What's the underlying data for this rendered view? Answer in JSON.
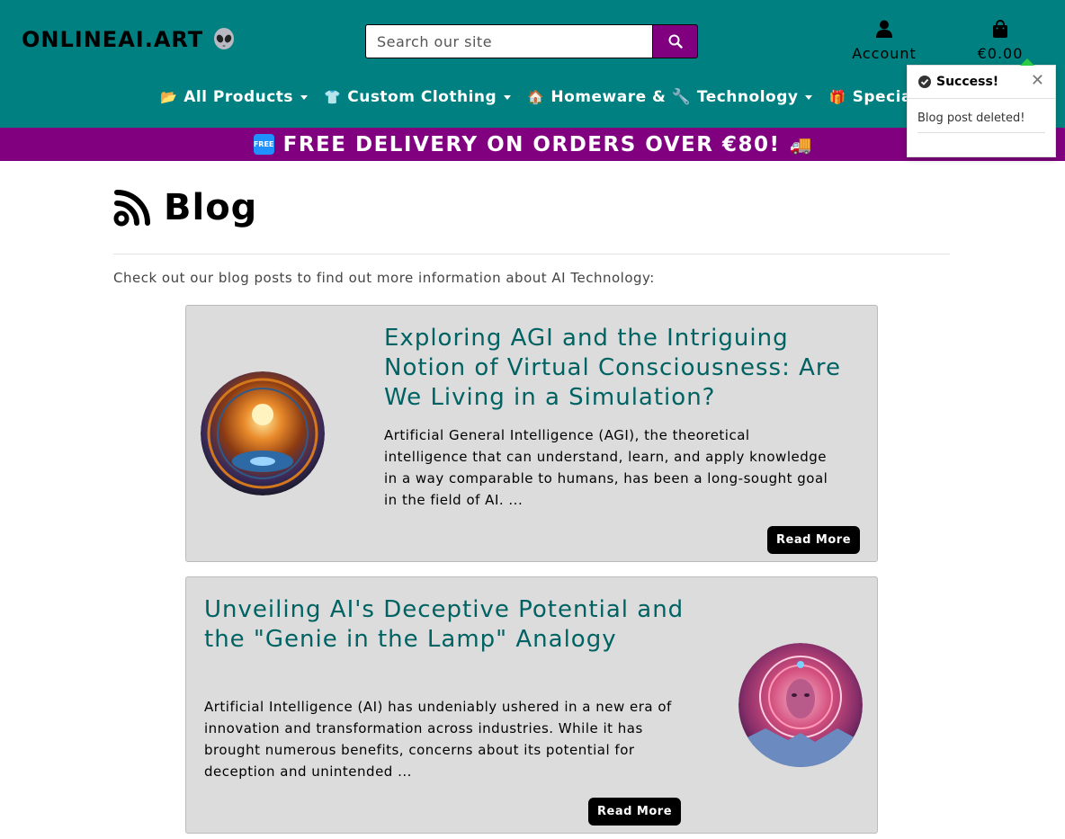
{
  "header": {
    "logo_text": "ONLINEAI.ART",
    "search": {
      "placeholder": "Search our site"
    },
    "account_label": "Account",
    "cart_total": "€0.00"
  },
  "nav": {
    "items": [
      {
        "label": "All Products",
        "icon": "folder-icon"
      },
      {
        "label": "Custom Clothing",
        "icon": "tshirt-icon"
      },
      {
        "label": "Homeware & 🔧 Technology",
        "icon": "house-icon"
      },
      {
        "label": "Special Offers",
        "icon": "gift-icon"
      }
    ]
  },
  "banner": {
    "badge": "FREE",
    "text": "FREE DELIVERY ON ORDERS OVER €80!"
  },
  "toast": {
    "title": "Success!",
    "message": "Blog post deleted!"
  },
  "page": {
    "title": "Blog",
    "intro": "Check out our blog posts to find out more information about AI Technology:"
  },
  "posts": [
    {
      "title": "Exploring AGI and the Intriguing Notion of Virtual Consciousness: Are We Living in a Simulation?",
      "excerpt": "Artificial General Intelligence (AGI), the theoretical intelligence that can understand, learn, and apply knowledge in a way comparable to humans, has been a long-sought goal in the field of AI. ...",
      "button": "Read More"
    },
    {
      "title": "Unveiling AI's Deceptive Potential and the \"Genie in the Lamp\" Analogy",
      "excerpt": "Artificial Intelligence (AI) has undeniably ushered in a new era of innovation and transformation across industries. While it has brought numerous benefits, concerns about its potential for deception and unintended ...",
      "button": "Read More"
    }
  ],
  "colors": {
    "header_bg": "#008080",
    "accent": "#800080",
    "card_bg": "#dcdcdc",
    "title_color": "#006262"
  }
}
